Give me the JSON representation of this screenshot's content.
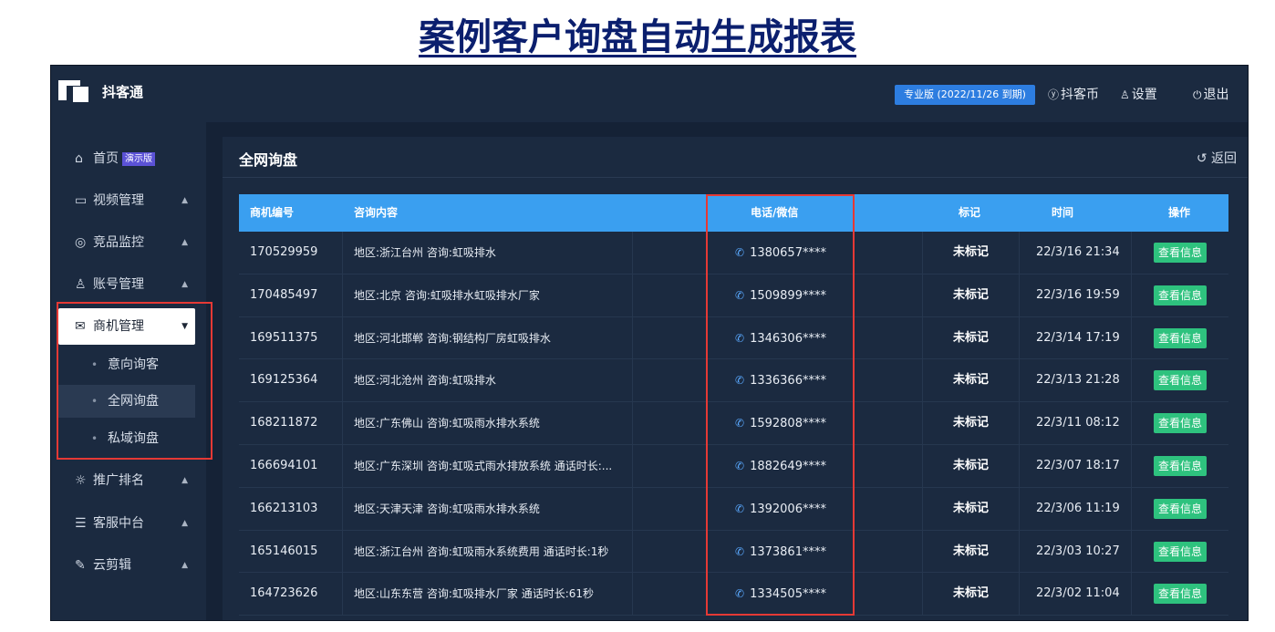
{
  "headline": "案例客户询盘自动生成报表",
  "app": {
    "name": "抖客通",
    "plan_badge": "专业版 (2022/11/26 到期)",
    "coins_label": "抖客币",
    "settings_label": "设置",
    "logout_label": "退出"
  },
  "sidebar": {
    "items": [
      {
        "label": "首页",
        "badge": "演示版",
        "icon": "home-icon"
      },
      {
        "label": "视频管理",
        "icon": "video-icon"
      },
      {
        "label": "竞品监控",
        "icon": "monitor-icon"
      },
      {
        "label": "账号管理",
        "icon": "users-icon"
      },
      {
        "label": "商机管理",
        "icon": "mail-icon"
      },
      {
        "label": "推广排名",
        "icon": "bulb-icon"
      },
      {
        "label": "客服中台",
        "icon": "chat-icon"
      },
      {
        "label": "云剪辑",
        "icon": "edit-icon"
      }
    ],
    "sub_items": [
      "意向询客",
      "全网询盘",
      "私域询盘"
    ]
  },
  "main": {
    "title": "全网询盘",
    "back_label": "返回",
    "columns": [
      "商机编号",
      "咨询内容",
      "电话/微信",
      "标记",
      "时间",
      "操作"
    ],
    "action_label": "查看信息",
    "rows": [
      {
        "id": "170529959",
        "content": "地区:浙江台州 咨询:虹吸排水",
        "phone": "1380657****",
        "mark": "未标记",
        "time": "22/3/16 21:34"
      },
      {
        "id": "170485497",
        "content": "地区:北京 咨询:虹吸排水虹吸排水厂家",
        "phone": "1509899****",
        "mark": "未标记",
        "time": "22/3/16 19:59"
      },
      {
        "id": "169511375",
        "content": "地区:河北邯郸 咨询:钢结构厂房虹吸排水",
        "phone": "1346306****",
        "mark": "未标记",
        "time": "22/3/14 17:19"
      },
      {
        "id": "169125364",
        "content": "地区:河北沧州 咨询:虹吸排水",
        "phone": "1336366****",
        "mark": "未标记",
        "time": "22/3/13 21:28"
      },
      {
        "id": "168211872",
        "content": "地区:广东佛山 咨询:虹吸雨水排水系统",
        "phone": "1592808****",
        "mark": "未标记",
        "time": "22/3/11 08:12"
      },
      {
        "id": "166694101",
        "content": "地区:广东深圳 咨询:虹吸式雨水排放系统 通话时长:...",
        "phone": "1882649****",
        "mark": "未标记",
        "time": "22/3/07 18:17"
      },
      {
        "id": "166213103",
        "content": "地区:天津天津 咨询:虹吸雨水排水系统",
        "phone": "1392006****",
        "mark": "未标记",
        "time": "22/3/06 11:19"
      },
      {
        "id": "165146015",
        "content": "地区:浙江台州 咨询:虹吸雨水系统费用 通话时长:1秒",
        "phone": "1373861****",
        "mark": "未标记",
        "time": "22/3/03 10:27"
      },
      {
        "id": "164723626",
        "content": "地区:山东东营 咨询:虹吸排水厂家 通话时长:61秒",
        "phone": "1334505****",
        "mark": "未标记",
        "time": "22/3/02 11:04"
      }
    ]
  },
  "colors": {
    "header_blue": "#3a9ff0",
    "badge_blue": "#2d7de0",
    "action_green": "#2ec27e",
    "highlight_red": "#e53935",
    "demo_purple": "#5b52d6"
  }
}
